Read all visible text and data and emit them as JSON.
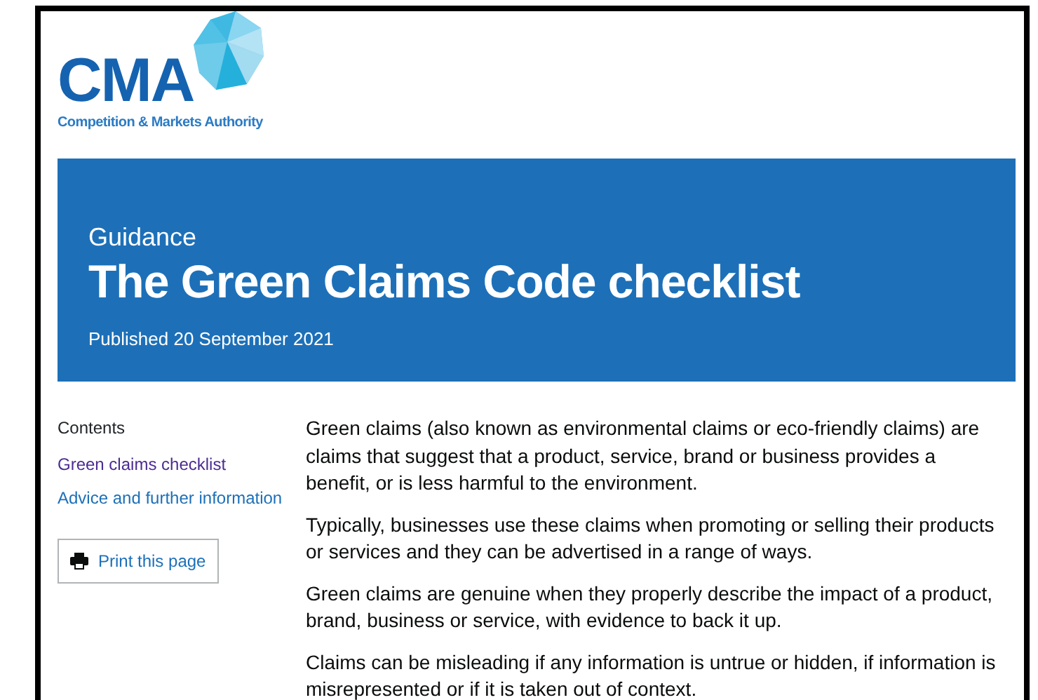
{
  "logo": {
    "acronym": "CMA",
    "name": "Competition & Markets Authority"
  },
  "banner": {
    "caption": "Guidance",
    "title": "The Green Claims Code checklist",
    "published": "Published 20 September 2021"
  },
  "contents": {
    "heading": "Contents",
    "links": [
      {
        "label": "Green claims checklist",
        "visited": true
      },
      {
        "label": "Advice and further information",
        "visited": false
      }
    ]
  },
  "print_button": {
    "label": "Print this page"
  },
  "paragraphs": [
    "Green claims (also known as environmental claims or eco-friendly claims) are claims that suggest that a product, service, brand or business provides a benefit, or is less harmful to the environment.",
    "Typically, businesses use these claims when promoting or selling their products or services and they can be advertised in a range of ways.",
    "Green claims are genuine when they properly describe the impact of a product, brand, business or service, with evidence to back it up.",
    "Claims can be misleading if any information is untrue or hidden, if information is misrepresented or if it is taken out of context."
  ]
}
